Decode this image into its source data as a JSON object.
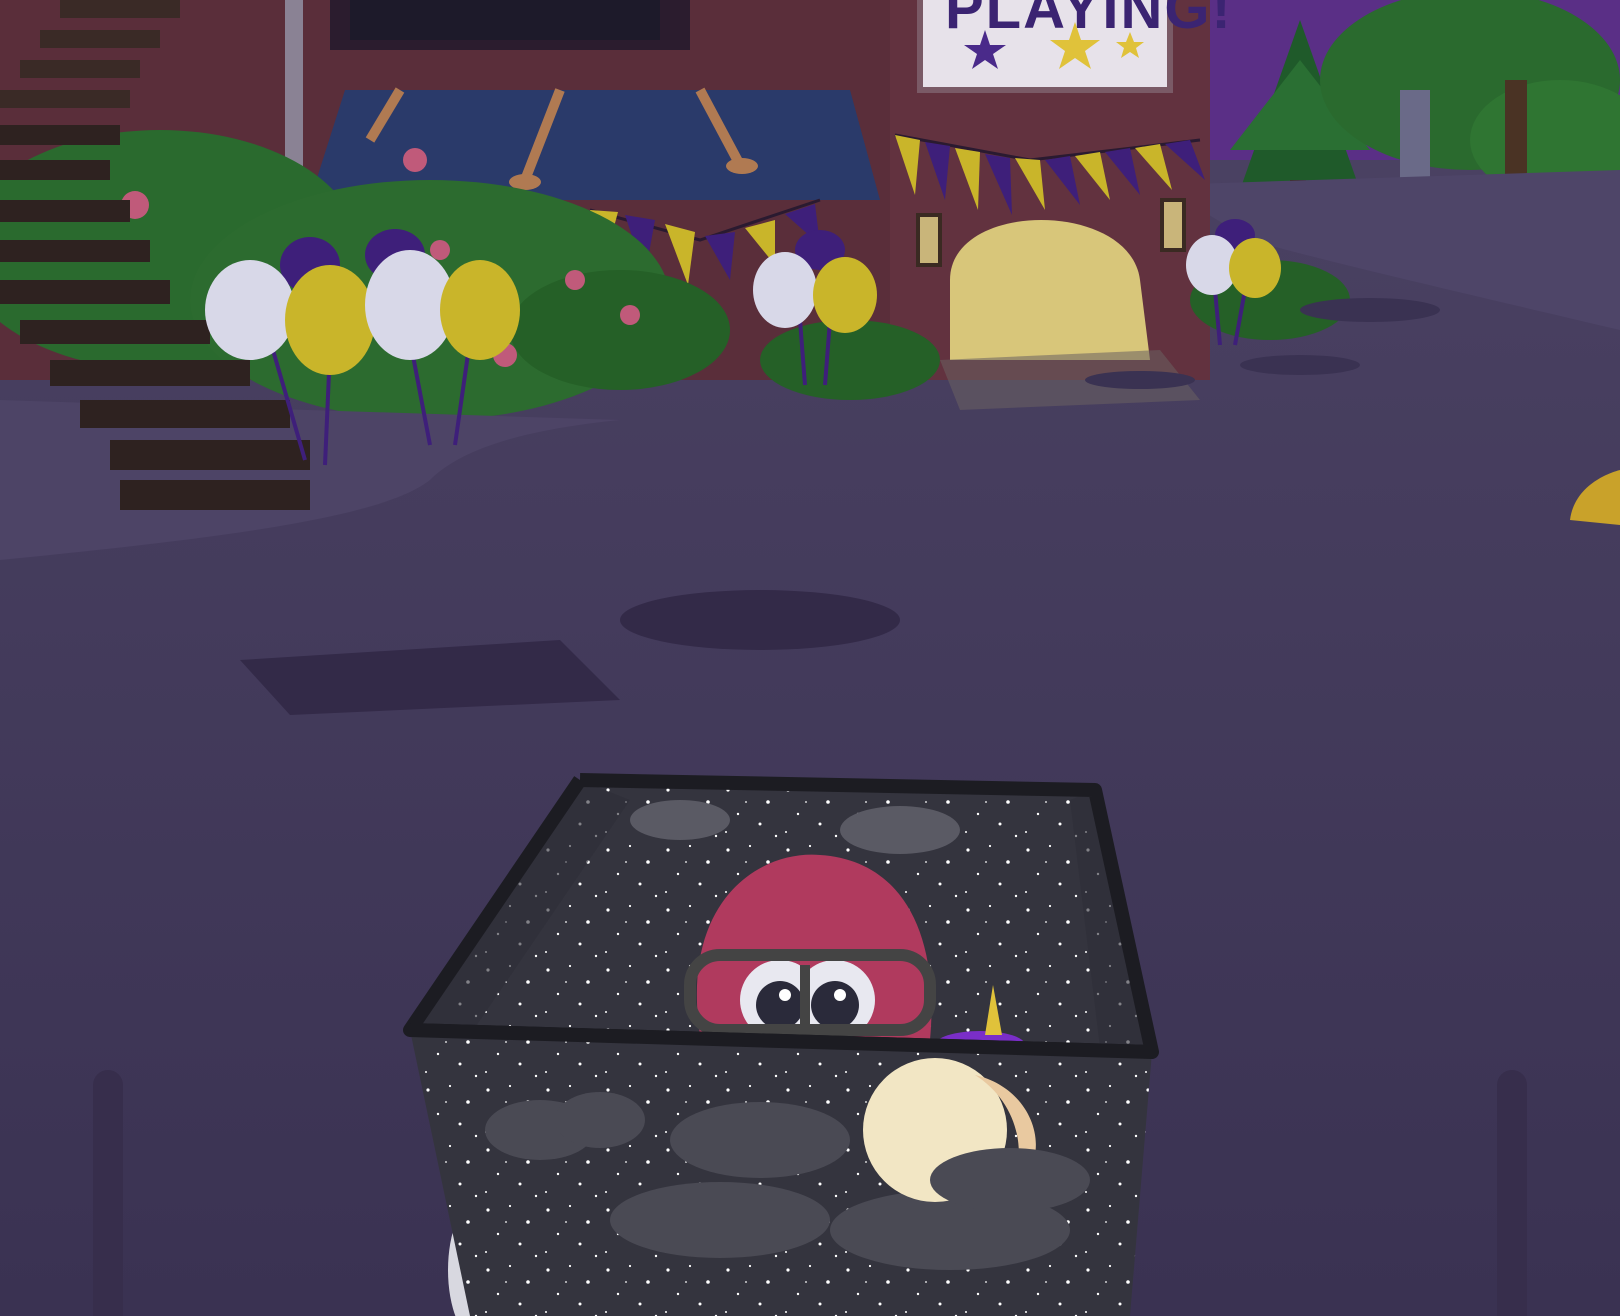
{
  "scene": {
    "sign_text": "PLAYING!",
    "colors": {
      "sky": "#5a2f86",
      "street": "#3e3556",
      "sidewalk": "#4d4466",
      "building": "#5a2e3a",
      "bush": "#2c6b2f",
      "pennant_yellow": "#c9b52a",
      "pennant_purple": "#3e1f7a",
      "doorway": "#d8c67a",
      "kart_body": "#3a3a44",
      "kart_trim": "#2a2a30",
      "toon_head": "#b03a5e",
      "moon": "#f2e6c4"
    },
    "icons": [
      "star-icon",
      "moon-icon",
      "cloud-icon",
      "balloon-icon",
      "lantern-icon"
    ]
  }
}
